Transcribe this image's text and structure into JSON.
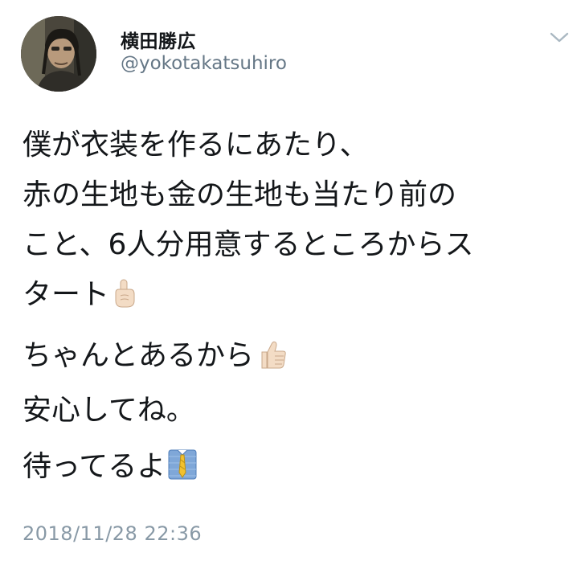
{
  "user": {
    "display_name": "横田勝広",
    "handle": "@yokotakatsuhiro",
    "avatar_icon": "profile-photo"
  },
  "menu": {
    "icon": "chevron-down-icon"
  },
  "tweet": {
    "paragraphs": [
      {
        "lines": [
          "僕が衣装を作るにあたり、",
          "赤の生地も金の生地も当たり前の",
          "こと、6人分用意するところからス",
          "タート"
        ],
        "emoji": "pointing-up-emoji"
      },
      {
        "lines": [
          "ちゃんとあるから",
          "安心してね。"
        ],
        "emoji": "thumbs-up-emoji"
      },
      {
        "lines": [
          "待ってるよ"
        ],
        "emoji": "office-worker-emoji"
      }
    ],
    "timestamp": "2018/11/28 22:36"
  },
  "colors": {
    "text": "#14171a",
    "secondary": "#657786",
    "timestamp": "#8899a6",
    "caret": "#aab8c2"
  }
}
